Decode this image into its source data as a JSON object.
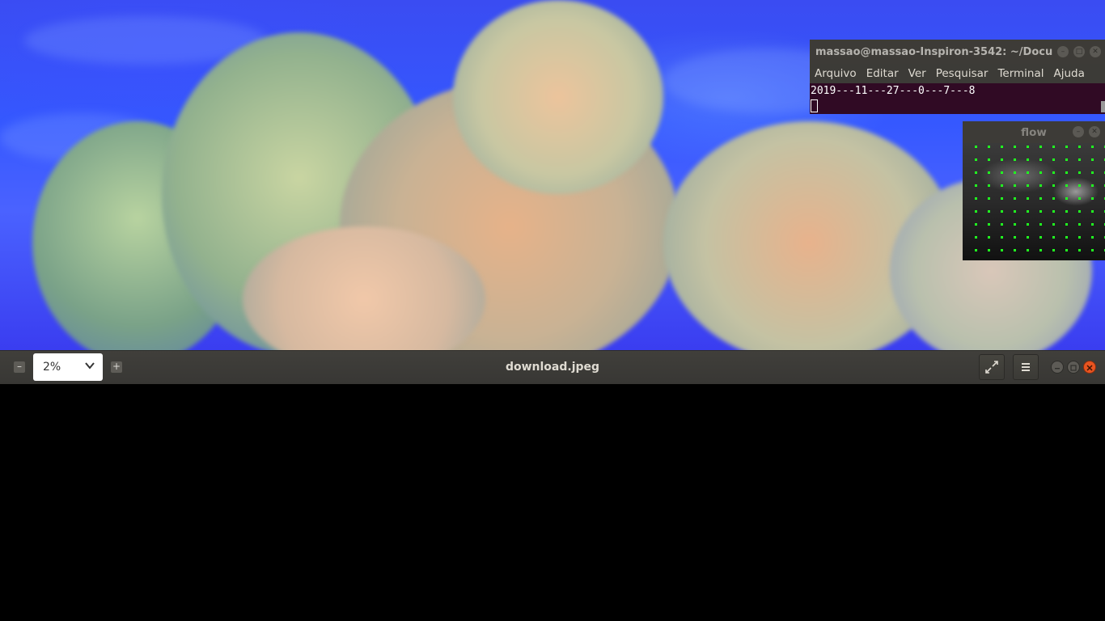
{
  "terminal": {
    "title": "massao@massao-Inspiron-3542: ~/Docu...",
    "menu": [
      "Arquivo",
      "Editar",
      "Ver",
      "Pesquisar",
      "Terminal",
      "Ajuda"
    ],
    "output_line": "2019---11---27---0---7---8"
  },
  "flow_window": {
    "title": "flow",
    "vector_color": "#20ff20"
  },
  "viewer": {
    "zoom": "2%",
    "filename": "download.jpeg"
  },
  "icons": [
    "minimize-icon",
    "maximize-icon",
    "close-icon",
    "zoom-out-icon",
    "zoom-in-icon",
    "chevron-down-icon",
    "fullscreen-icon",
    "hamburger-menu-icon"
  ]
}
